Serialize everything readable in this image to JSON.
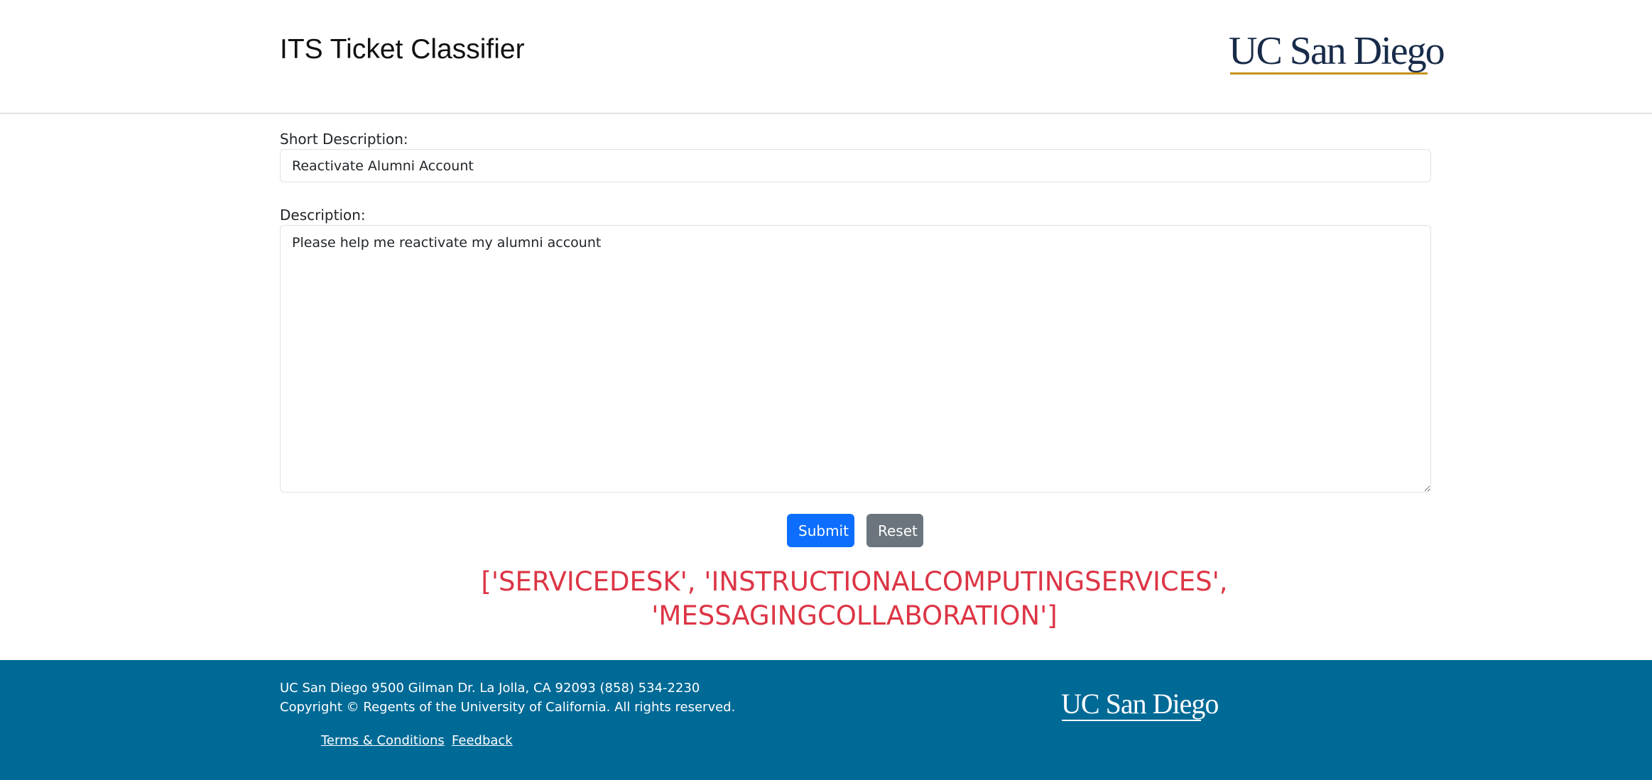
{
  "header": {
    "title": "ITS Ticket Classifier",
    "logo_text": "UC San Diego"
  },
  "form": {
    "short_description_label": "Short Description:",
    "short_description_value": "Reactivate Alumni Account",
    "description_label": "Description:",
    "description_value": "Please help me reactivate my alumni account",
    "submit_label": "Submit",
    "reset_label": "Reset"
  },
  "result": {
    "text": "['SERVICEDESK', 'INSTRUCTIONALCOMPUTINGSERVICES', 'MESSAGINGCOLLABORATION']"
  },
  "footer": {
    "address": "UC San Diego 9500 Gilman Dr. La Jolla, CA 92093 (858) 534-2230",
    "copyright": "Copyright © Regents of the University of California. All rights reserved.",
    "links": [
      {
        "label": "Terms & Conditions"
      },
      {
        "label": "Feedback"
      }
    ],
    "logo_text": "UC San Diego"
  },
  "colors": {
    "submit": "#0d6efd",
    "reset": "#6c757d",
    "result": "#dc3545",
    "footer_bg": "#006a96",
    "logo_navy": "#182b49",
    "logo_gold": "#c69214"
  }
}
